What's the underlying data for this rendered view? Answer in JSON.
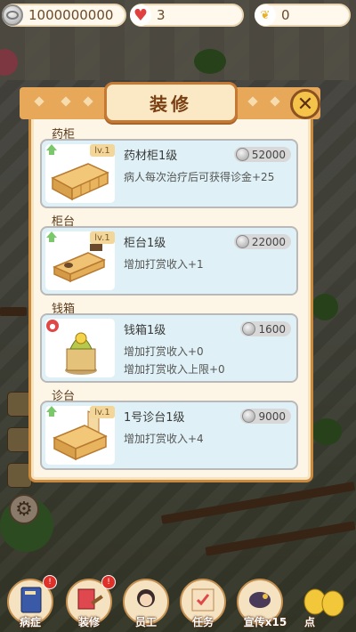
{
  "status": {
    "coins": "1000000000",
    "hearts": "3",
    "leaves": "0"
  },
  "dialog": {
    "title": "装修",
    "close_icon": "close-x-icon"
  },
  "items": [
    {
      "category": "药柜",
      "level": "lv.1",
      "name": "药材柜1级",
      "price": "52000",
      "desc1": "病人每次治疗后可获得诊金+25",
      "desc2": "",
      "icon": "medicine-cabinet-icon",
      "state": "upgradable"
    },
    {
      "category": "柜台",
      "level": "lv.1",
      "name": "柜台1级",
      "price": "22000",
      "desc1": "增加打赏收入+1",
      "desc2": "",
      "icon": "counter-icon",
      "state": "upgradable"
    },
    {
      "category": "钱箱",
      "level": "",
      "name": "钱箱1级",
      "price": "1600",
      "desc1": "增加打赏收入+0",
      "desc2": "增加打赏收入上限+0",
      "icon": "money-box-icon",
      "state": "locked"
    },
    {
      "category": "诊台",
      "level": "lv.1",
      "name": "1号诊台1级",
      "price": "9000",
      "desc1": "增加打赏收入+4",
      "desc2": "",
      "icon": "consult-table-icon",
      "state": "upgradable"
    }
  ],
  "nav": [
    {
      "label": "病症",
      "icon": "medical-book-icon",
      "badge": "!"
    },
    {
      "label": "装修",
      "icon": "brush-icon",
      "badge": "!"
    },
    {
      "label": "员工",
      "icon": "staff-icon",
      "badge": ""
    },
    {
      "label": "任务",
      "icon": "task-icon",
      "badge": ""
    },
    {
      "label": "宣传x15",
      "icon": "crow-icon",
      "badge": ""
    },
    {
      "label": "点",
      "icon": "money-bag-icon",
      "badge": ""
    }
  ],
  "colors": {
    "panel_border": "#c98a3d",
    "card_bg": "#dff1f6",
    "title_text": "#7a3f12"
  }
}
